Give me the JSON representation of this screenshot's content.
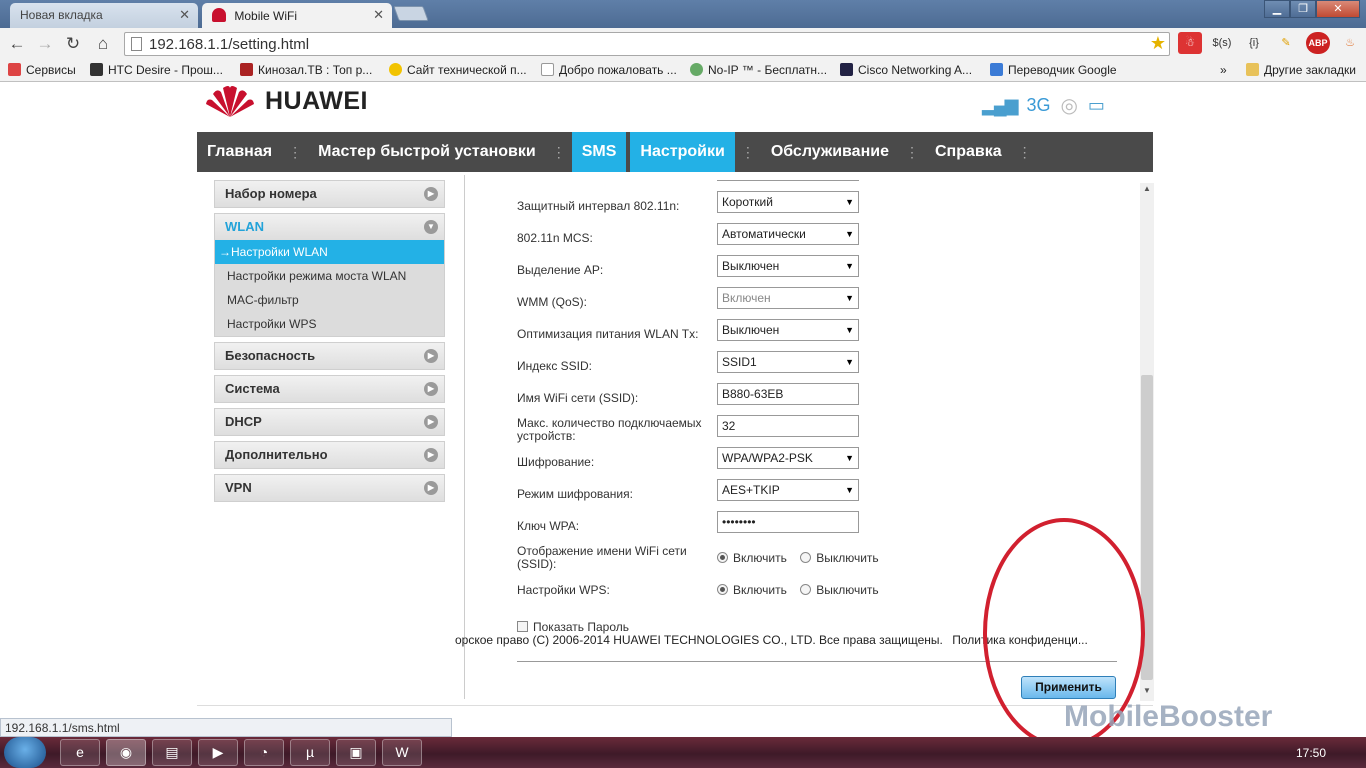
{
  "browser": {
    "tabs": [
      {
        "label": "Новая вкладка",
        "active": false
      },
      {
        "label": "Mobile WiFi",
        "active": true
      }
    ],
    "window_controls": {
      "minimize": "▁",
      "maximize": "❐",
      "close": "✕"
    },
    "address": "192.168.1.1/setting.html",
    "extensions": [
      "$(s)",
      "{i}",
      "ABP"
    ],
    "bookmarks": [
      {
        "label": "Сервисы",
        "icon": "apps-icon",
        "color": "#d44"
      },
      {
        "label": "HTC Desire - Прош...",
        "icon": "htc-icon",
        "color": "#333"
      },
      {
        "label": "Кинозал.ТВ : Топ р...",
        "icon": "kinozal-icon",
        "color": "#a22"
      },
      {
        "label": "Сайт технической п...",
        "icon": "beeline-icon",
        "color": "#f2c300"
      },
      {
        "label": "Добро пожаловать ...",
        "icon": "page-icon",
        "color": "#ddd"
      },
      {
        "label": "No-IP ™ - Бесплатн...",
        "icon": "noip-icon",
        "color": "#6a6"
      },
      {
        "label": "Cisco Networking A...",
        "icon": "cisco-icon",
        "color": "#224"
      },
      {
        "label": "Переводчик Google",
        "icon": "translate-icon",
        "color": "#3b7bd6"
      }
    ],
    "more_bookmarks_chevron": "»",
    "other_bookmarks": "Другие закладки",
    "status_url": "192.168.1.1/sms.html"
  },
  "header": {
    "brand": "HUAWEI",
    "network_type": "3G"
  },
  "mainnav": [
    {
      "label": "Главная",
      "active": false
    },
    {
      "label": "Мастер быстрой установки",
      "active": false
    },
    {
      "label": "SMS",
      "active": true
    },
    {
      "label": "Настройки",
      "active": true
    },
    {
      "label": "Обслуживание",
      "active": false
    },
    {
      "label": "Справка",
      "active": false
    }
  ],
  "sidebar": {
    "dial": "Набор номера",
    "wlan": "WLAN",
    "wlan_items": [
      "Настройки WLAN",
      "Настройки режима моста WLAN",
      "MAC-фильтр",
      "Настройки WPS"
    ],
    "current_marker": "→",
    "security": "Безопасность",
    "system": "Система",
    "dhcp": "DHCP",
    "advanced": "Дополнительно",
    "vpn": "VPN"
  },
  "form": {
    "guard_interval": {
      "label": "Защитный интервал 802.11n:",
      "value": "Короткий"
    },
    "mcs": {
      "label": "802.11n MCS:",
      "value": "Автоматически"
    },
    "ap_isolation": {
      "label": "Выделение AP:",
      "value": "Выключен"
    },
    "wmm": {
      "label": "WMM (QoS):",
      "value": "Включен"
    },
    "tx_power": {
      "label": "Оптимизация питания WLAN Tx:",
      "value": "Выключен"
    },
    "ssid_index": {
      "label": "Индекс SSID:",
      "value": "SSID1"
    },
    "ssid_name": {
      "label": "Имя WiFi сети (SSID):",
      "value": "B880-63EB"
    },
    "max_devices": {
      "label": "Макс. количество подключаемых устройств:",
      "value": "32"
    },
    "encryption": {
      "label": "Шифрование:",
      "value": "WPA/WPA2-PSK"
    },
    "encryption_mode": {
      "label": "Режим шифрования:",
      "value": "AES+TKIP"
    },
    "wpa_key": {
      "label": "Ключ WPA:",
      "value": "••••••••"
    },
    "ssid_broadcast": {
      "label": "Отображение имени WiFi сети (SSID):",
      "on": "Включить",
      "off": "Выключить"
    },
    "wps": {
      "label": "Настройки WPS:",
      "on": "Включить",
      "off": "Выключить"
    },
    "show_password": "Показать Пароль",
    "apply": "Применить"
  },
  "footer": {
    "copyright": "орское право (C) 2006-2014 HUAWEI TECHNOLOGIES CO., LTD. Все права защищены.",
    "privacy": "Политика конфиденци..."
  },
  "taskbar": {
    "clock": "17:50"
  },
  "watermark": "MobileBooster",
  "colors": {
    "accent": "#23b1e6",
    "nav_bg": "#4a4a4a",
    "annotation_red": "#d1202f"
  }
}
